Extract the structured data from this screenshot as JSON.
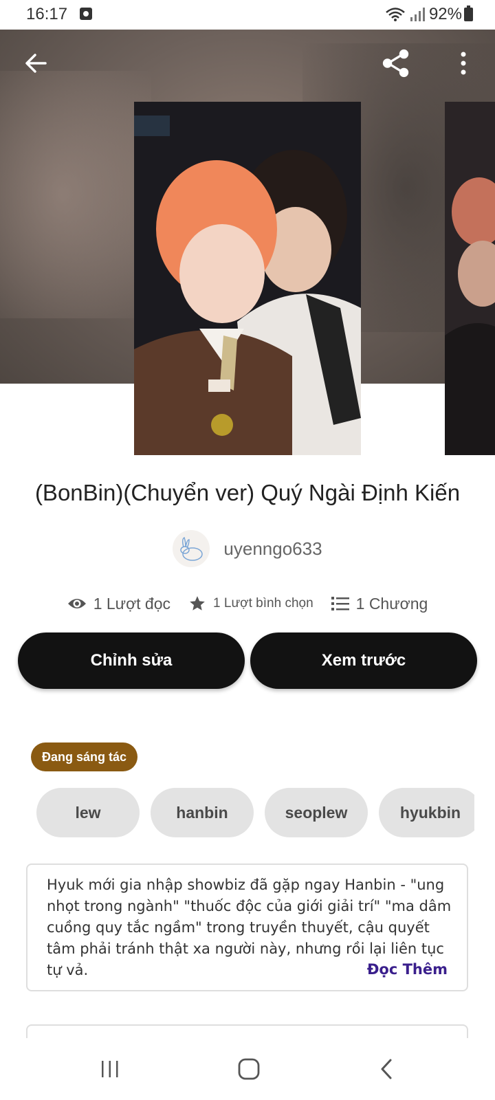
{
  "status_bar": {
    "time": "16:17",
    "battery": "92%"
  },
  "story": {
    "title": "(BonBin)(Chuyển ver) Quý Ngài Định Kiến",
    "author": "uyenngo633",
    "reads": "1 Lượt đọc",
    "votes": "1 Lượt bình chọn",
    "chapters": "1 Chương",
    "status": "Đang sáng tác",
    "tags": [
      "lew",
      "hanbin",
      "seoplew",
      "hyukbin"
    ],
    "description": "Hyuk mới gia nhập showbiz đã gặp ngay Hanbin - \"ung nhọt trong ngành\" \"thuốc độc của giới giải trí\" \"ma dâm cuồng quy tắc ngầm\" trong truyền thuyết, cậu quyết tâm phải tránh thật xa người này, nhưng rồi lại liên tục tự vả.",
    "read_more": "Đọc Thêm"
  },
  "actions": {
    "edit": "Chỉnh sửa",
    "preview": "Xem trước"
  },
  "icons": {
    "back": "arrow-left-icon",
    "share": "share-icon",
    "more": "more-vertical-icon",
    "reads": "eye-icon",
    "votes": "star-icon",
    "chapters": "list-icon"
  },
  "colors": {
    "status_tag": "#8a5a12",
    "read_more": "#3a1f8c",
    "button": "#121212"
  }
}
